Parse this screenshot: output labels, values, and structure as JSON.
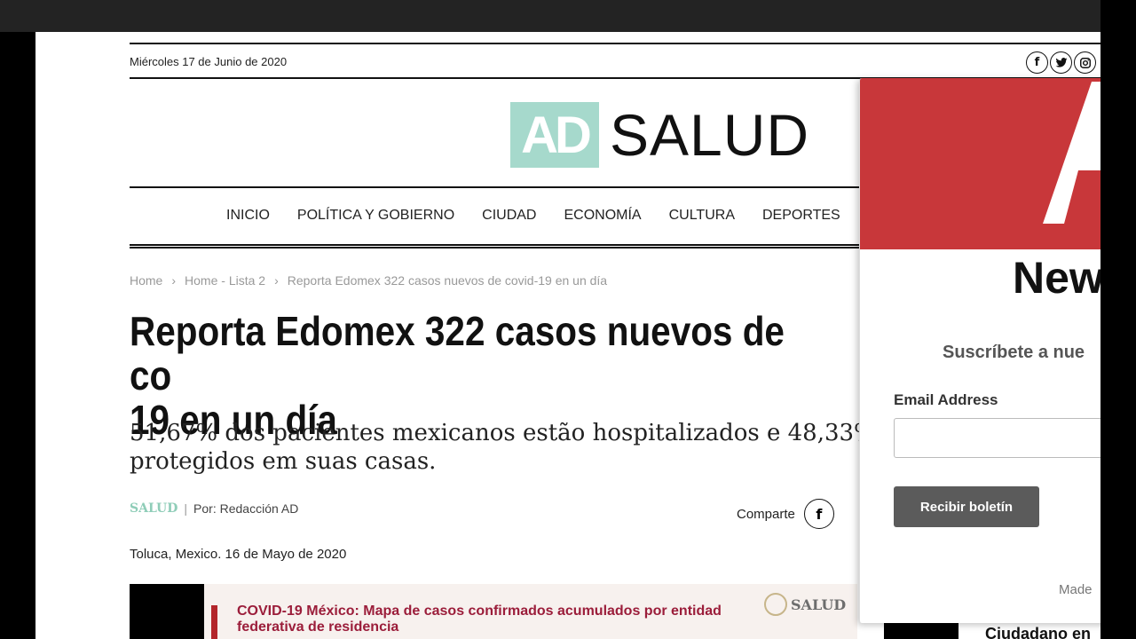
{
  "header": {
    "date": "Miércoles 17 de Junio de 2020",
    "social": [
      {
        "icon": "facebook-icon",
        "glyph": "f"
      },
      {
        "icon": "twitter-icon",
        "glyph": "t"
      },
      {
        "icon": "instagram-icon",
        "glyph": "◎"
      }
    ]
  },
  "logo": {
    "ad": "AD",
    "name": "SALUD"
  },
  "nav": {
    "items": [
      "INICIO",
      "POLÍTICA Y GOBIERNO",
      "CIUDAD",
      "ECONOMÍA",
      "CULTURA",
      "DEPORTES"
    ]
  },
  "breadcrumb": {
    "home": "Home",
    "list": "Home - Lista 2",
    "current": "Reporta Edomex 322 casos nuevos de covid-19 en un día",
    "separator": "›"
  },
  "article": {
    "headline_line1": "Reporta Edomex 322 casos nuevos de co",
    "headline_line2": "19 en un día",
    "subtitle": "51,67% dos pacientes mexicanos estão hospitalizados e 48,33% protegidos em suas casas.",
    "category": "SALUD",
    "meta_sep": "|",
    "author": "Por: Redacción AD",
    "share_label": "Comparte",
    "location": "Toluca, Mexico. 16 de Mayo de 2020",
    "image": {
      "title": "COVID-19 México: Mapa de casos confirmados acumulados por entidad federativa de residencia",
      "seal_text": "SALUD"
    }
  },
  "sidebar": {
    "text": "Ciudadano en"
  },
  "popup": {
    "title": "New",
    "description": "Suscríbete a nue",
    "email_label": "Email Address",
    "email_value": "",
    "email_placeholder": "",
    "button_label": "Recibir boletín",
    "footer": "Made"
  },
  "colors": {
    "accent": "#a6d9cc",
    "popup_banner": "#c8373a",
    "button": "#5b5b5b"
  }
}
